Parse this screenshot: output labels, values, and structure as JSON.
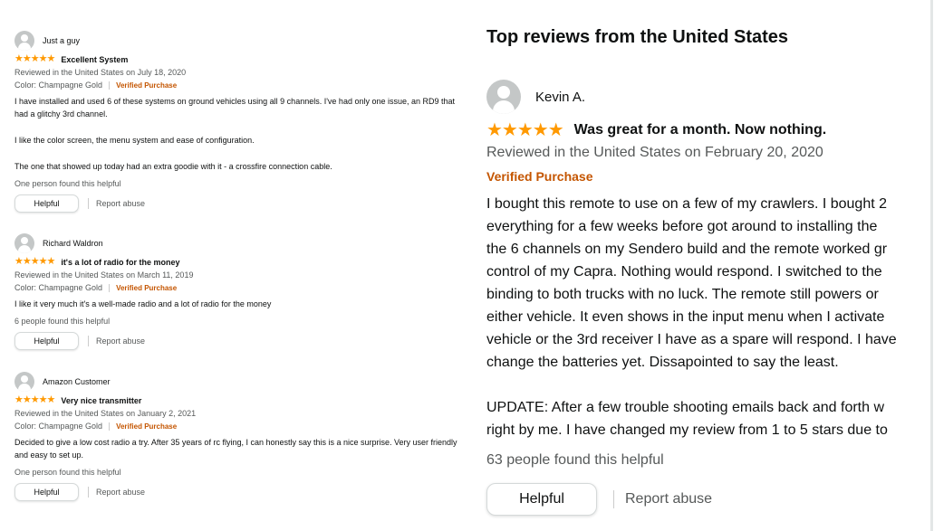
{
  "left_reviews": [
    {
      "author": "Just a guy",
      "stars": "★★★★★",
      "title": "Excellent System",
      "date_line": "Reviewed in the United States on July 18, 2020",
      "color_line": "Color: Champagne Gold",
      "verified": "Verified Purchase",
      "body": [
        "I have installed and used 6 of these systems on ground vehicles using all 9 channels. I've had only one issue, an RD9 that had a glitchy 3rd channel.",
        "I like the color screen, the menu system and ease of configuration.",
        "The one that showed up today had an extra goodie with it - a crossfire connection cable."
      ],
      "helpful_count": "One person found this helpful",
      "helpful_button": "Helpful",
      "report": "Report abuse"
    },
    {
      "author": "Richard Waldron",
      "stars": "★★★★★",
      "title": "it's a lot of radio for the money",
      "date_line": "Reviewed in the United States on March 11, 2019",
      "color_line": "Color: Champagne Gold",
      "verified": "Verified Purchase",
      "body": [
        "I like it very much it's a well-made radio and a lot of radio for the money"
      ],
      "helpful_count": "6 people found this helpful",
      "helpful_button": "Helpful",
      "report": "Report abuse"
    },
    {
      "author": "Amazon Customer",
      "stars": "★★★★★",
      "title": "Very nice transmitter",
      "date_line": "Reviewed in the United States on January 2, 2021",
      "color_line": "Color: Champagne Gold",
      "verified": "Verified Purchase",
      "body": [
        "Decided to give a low cost radio a try. After 35 years of rc flying, I can honestly say this is a nice surprise. Very user friendly and easy to set up."
      ],
      "helpful_count": "One person found this helpful",
      "helpful_button": "Helpful",
      "report": "Report abuse"
    }
  ],
  "right_review": {
    "heading": "Top reviews from the United States",
    "author": "Kevin A.",
    "stars": "★★★★★",
    "title": "Was great for a month. Now nothing.",
    "date_line": "Reviewed in the United States on February 20, 2020",
    "verified": "Verified Purchase",
    "body_lines": [
      "I bought this remote to use on a few of my crawlers. I bought 2",
      "everything for a few weeks before got around to installing the",
      "the 6 channels on my Sendero build and the remote worked gr",
      "control of my Capra. Nothing would respond. I switched to the",
      "binding to both trucks with no luck. The remote still powers or",
      "either vehicle. It even shows in the input menu when I activate",
      "vehicle or the 3rd receiver I have as a spare will respond. I have",
      "change the batteries yet. Dissapointed to say the least."
    ],
    "update_lines": [
      "UPDATE: After a few trouble shooting emails back and forth w",
      "right by me. I have changed my review from 1 to 5 stars due to"
    ],
    "helpful_count": "63 people found this helpful",
    "helpful_button": "Helpful",
    "report": "Report abuse"
  },
  "colors": {
    "star": "#ff9900",
    "verified": "#c45500",
    "muted": "#565959",
    "avatar": "#c4c7c7"
  },
  "icons": [
    "user-avatar-icon",
    "star-rating-icon"
  ]
}
